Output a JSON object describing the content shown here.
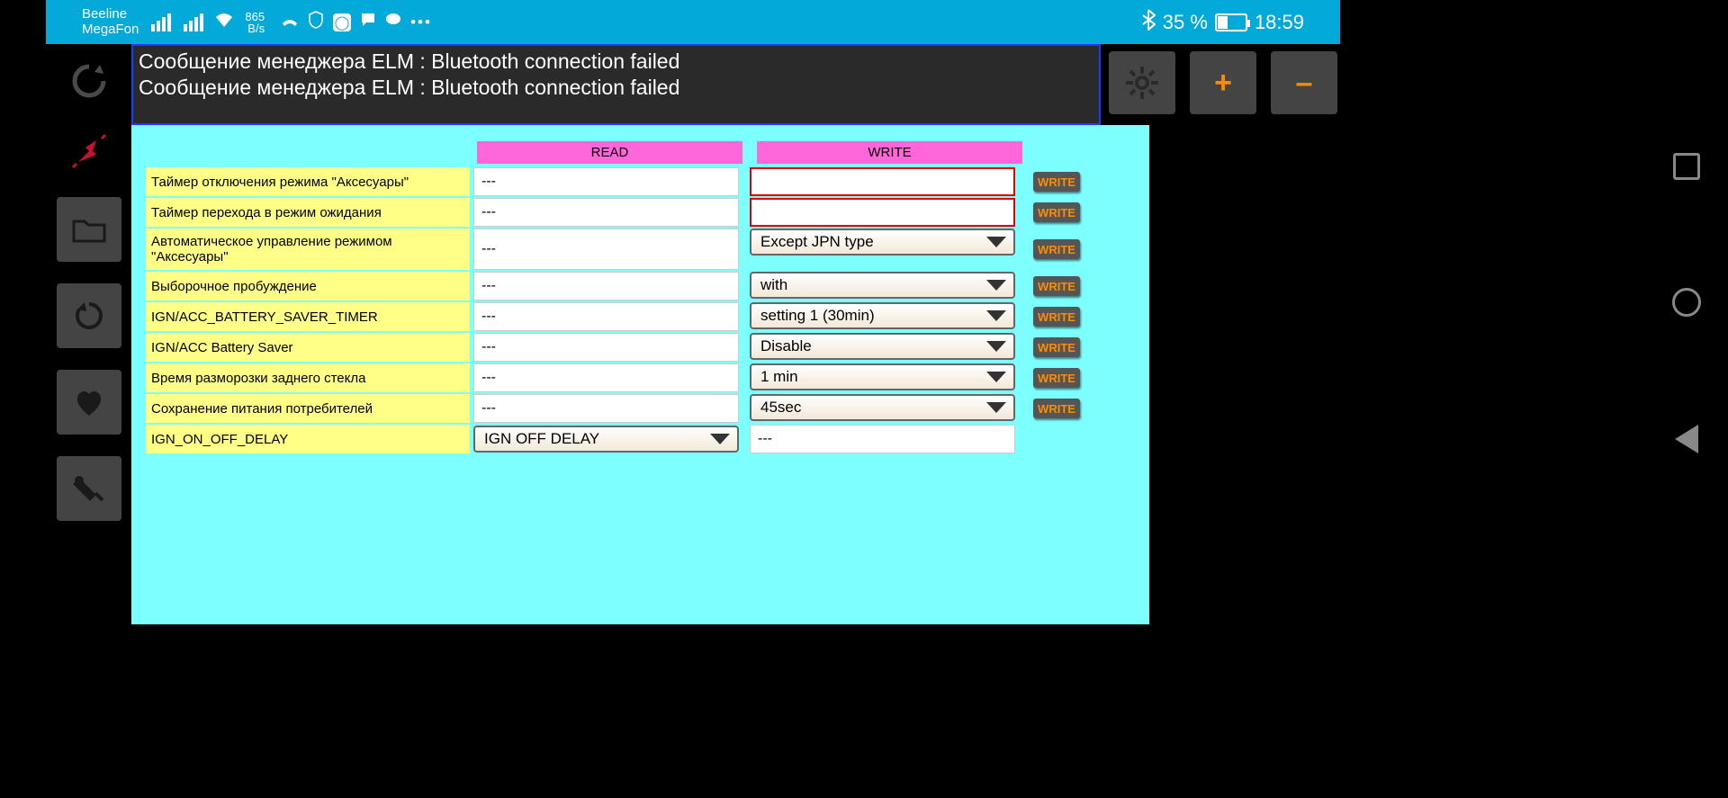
{
  "status": {
    "carrier1": "Beeline",
    "carrier2": "MegaFon",
    "data_rate_num": "865",
    "data_rate_unit": "B/s",
    "battery_pct": "35 %",
    "time": "18:59"
  },
  "messages": {
    "line1": "Сообщение менеджера ELM : Bluetooth connection failed",
    "line2": "Сообщение менеджера ELM : Bluetooth connection failed"
  },
  "topright": {
    "plus": "+",
    "minus": "–"
  },
  "headers": {
    "read": "READ",
    "write": "WRITE"
  },
  "buttons": {
    "write": "WRITE"
  },
  "rows": [
    {
      "label": "Таймер отключения режима \"Аксесуары\"",
      "read": "---",
      "write_type": "input",
      "write_val": ""
    },
    {
      "label": "Таймер перехода в режим ожидания",
      "read": "---",
      "write_type": "input",
      "write_val": ""
    },
    {
      "label": "Автоматическое управление режимом \"Аксесуары\"",
      "read": "---",
      "write_type": "dropdown",
      "write_val": "Except JPN type"
    },
    {
      "label": "Выборочное пробуждение",
      "read": "---",
      "write_type": "dropdown",
      "write_val": "with"
    },
    {
      "label": "IGN/ACC_BATTERY_SAVER_TIMER",
      "read": "---",
      "write_type": "dropdown",
      "write_val": "setting 1 (30min)"
    },
    {
      "label": "IGN/ACC Battery Saver",
      "read": "---",
      "write_type": "dropdown",
      "write_val": "Disable"
    },
    {
      "label": "Время разморозки заднего стекла",
      "read": "---",
      "write_type": "dropdown",
      "write_val": "1 min"
    },
    {
      "label": "Сохранение питания потребителей",
      "read": "---",
      "write_type": "dropdown",
      "write_val": "45sec"
    },
    {
      "label": "IGN_ON_OFF_DELAY",
      "read_type": "dropdown",
      "read": "IGN OFF DELAY",
      "write_type": "plain",
      "write_val": "---"
    }
  ]
}
